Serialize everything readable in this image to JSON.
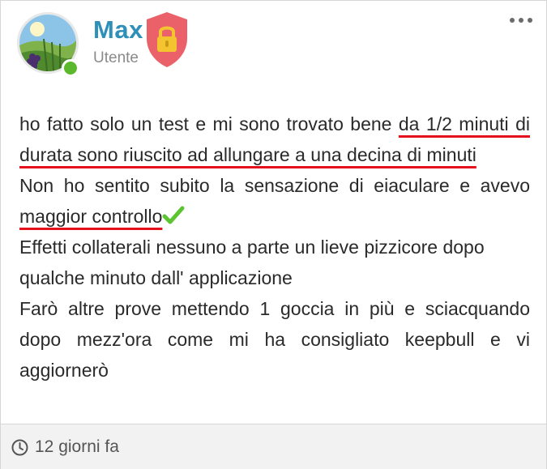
{
  "author": {
    "name": "Max",
    "role": "Utente",
    "online": true
  },
  "post": {
    "line1_a": "ho fatto solo un test e mi sono trovato bene ",
    "line1_b": "da 1/2 minuti di durata sono riuscito ad allungare a una decina di minuti",
    "line2_a": "Non ho sentito subito la sensazione di eiaculare e avevo ",
    "line2_b": "maggior controllo",
    "line3": "Effetti collaterali nessuno a parte un lieve pizzicore dopo qualche minuto dall' applicazione",
    "line4": "Farò altre prove mettendo 1 goccia in più e sciacquando dopo mezz'ora come mi ha consigliato keepbull e vi aggiornerò"
  },
  "footer": {
    "timestamp": "12 giorni fa"
  },
  "colors": {
    "username": "#2e8fb8",
    "highlight_underline": "#e4101c",
    "online": "#5cb82c",
    "shield": "#e8545c",
    "lock": "#f4c430",
    "check": "#5cc431"
  },
  "icons": {
    "menu": "more-horizontal-icon",
    "badge": "shield-lock-icon",
    "check": "checkmark-icon",
    "time": "clock-icon"
  }
}
